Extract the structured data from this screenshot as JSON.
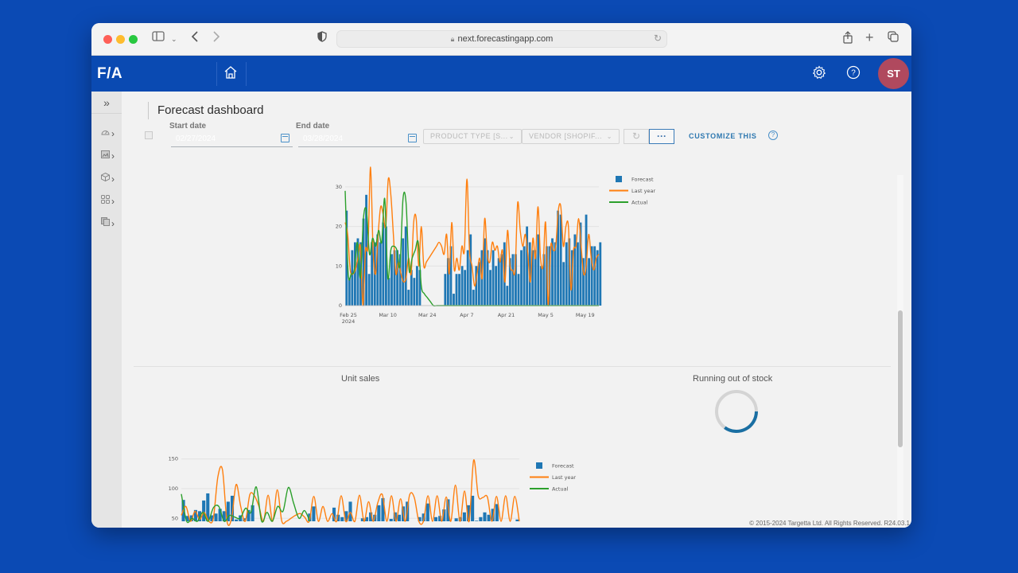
{
  "browser": {
    "url": "next.forecastingapp.com",
    "icons": [
      "sidebar-icon",
      "chevron-down-icon",
      "back-icon",
      "forward-icon",
      "shield-icon",
      "lock-icon",
      "reload-icon",
      "share-icon",
      "new-tab-icon",
      "tabs-icon"
    ]
  },
  "app": {
    "logo": "F/A",
    "avatar_initials": "ST",
    "colors": {
      "brand": "#0a4ab2",
      "avatar": "#b0495e",
      "forecast": "#1f77b4",
      "last_year": "#ff7f0e",
      "actual": "#2ca02c",
      "accent": "#2e78b0"
    }
  },
  "sidebar": {
    "expand_glyph": "»",
    "items": [
      {
        "name": "dashboard",
        "icon": "gauge-icon"
      },
      {
        "name": "reports",
        "icon": "image-icon"
      },
      {
        "name": "products",
        "icon": "cube-icon"
      },
      {
        "name": "apps",
        "icon": "grid-icon"
      },
      {
        "name": "documents",
        "icon": "copy-icon"
      }
    ]
  },
  "page": {
    "title": "Forecast dashboard",
    "filters": {
      "start_date_label": "Start date",
      "start_date_value": "02/27/2024",
      "end_date_label": "End date",
      "end_date_value": "03/28/2024",
      "product_type": "PRODUCT TYPE [S...",
      "vendor": "VENDOR [SHOPIF...",
      "more_label": "···",
      "customize_label": "CUSTOMIZE THIS",
      "help_label": "?"
    }
  },
  "sections": {
    "unit_sales_title": "Unit sales",
    "running_out_title": "Running out of stock",
    "spinner_progress": 0.35
  },
  "footer": {
    "text": "© 2015-2024 Targetta Ltd. All Rights Reserved. R24.03.1"
  },
  "chart_data": [
    {
      "type": "bar",
      "title": "",
      "legend": [
        "Forecast",
        "Last year",
        "Actual"
      ],
      "legend_position": "top-right",
      "x_start": "2024-02-25",
      "x_ticks": [
        "Feb 25\n2024",
        "Mar 10",
        "Mar 24",
        "Apr 7",
        "Apr 21",
        "May 5",
        "May 19"
      ],
      "y_ticks": [
        0,
        10,
        20,
        30
      ],
      "ylim": [
        0,
        35
      ],
      "days": 88,
      "series": [
        {
          "name": "Forecast",
          "kind": "bar",
          "values": [
            24,
            7,
            14,
            16,
            17,
            16,
            22,
            28,
            8,
            16,
            16,
            18,
            16,
            21,
            20,
            7,
            13,
            14,
            14,
            13,
            17,
            20,
            4,
            9,
            7,
            10,
            9,
            0,
            0,
            0,
            0,
            0,
            0,
            0,
            0,
            8,
            12,
            15,
            3,
            8,
            8,
            10,
            9,
            14,
            18,
            4,
            10,
            11,
            14,
            17,
            14,
            9,
            14,
            10,
            12,
            13,
            16,
            5,
            12,
            13,
            13,
            8,
            14,
            15,
            20,
            16,
            14,
            14,
            18,
            10,
            13,
            15,
            15,
            17,
            16,
            24,
            23,
            11,
            16,
            17,
            14,
            18,
            16,
            21,
            12,
            23,
            12,
            15,
            15,
            14,
            16
          ]
        },
        {
          "name": "Last year",
          "kind": "line",
          "values": [
            21,
            18,
            9,
            8,
            9,
            12,
            15,
            0,
            14,
            15,
            35,
            14,
            8,
            18,
            25,
            23,
            20,
            32,
            28,
            18,
            8,
            11,
            8,
            6,
            7,
            12,
            8,
            21,
            22,
            10,
            20,
            10,
            11,
            12,
            13,
            14,
            15,
            16,
            15,
            13,
            18,
            8,
            21,
            9,
            12,
            9,
            15,
            14,
            32,
            14,
            10,
            5,
            8,
            12,
            7,
            22,
            13,
            11,
            16,
            14,
            15,
            11,
            14,
            6,
            19,
            10,
            9,
            9,
            26,
            19,
            15,
            18,
            13,
            6,
            17,
            12,
            25,
            12,
            10,
            21,
            0,
            15,
            14,
            15,
            24,
            25,
            15,
            20,
            20,
            4,
            14,
            15,
            22,
            15,
            8,
            10,
            18,
            12,
            9,
            12,
            13
          ]
        },
        {
          "name": "Actual",
          "kind": "line",
          "values": [
            29,
            8,
            8,
            9,
            16,
            7,
            22,
            24,
            13,
            17,
            15,
            19,
            16,
            27,
            7,
            14,
            15,
            14,
            10,
            27,
            26,
            9,
            12,
            14,
            16,
            5,
            3,
            2,
            1,
            0,
            0
          ]
        }
      ]
    },
    {
      "type": "bar",
      "title": "Unit sales",
      "legend": [
        "Forecast",
        "Last year",
        "Actual"
      ],
      "legend_position": "top-right",
      "y_ticks": [
        50,
        100,
        150
      ],
      "ylim": [
        45,
        155
      ],
      "series": [
        {
          "name": "Forecast",
          "kind": "bar",
          "values": [
            81,
            54,
            55,
            64,
            62,
            80,
            92,
            55,
            58,
            66,
            62,
            78,
            88,
            48,
            55,
            50,
            64,
            72,
            45,
            45,
            45,
            45,
            45,
            45,
            45,
            45,
            45,
            45,
            45,
            45,
            45,
            58,
            70,
            45,
            45,
            45,
            45,
            68,
            56,
            52,
            62,
            78,
            45,
            45,
            50,
            52,
            60,
            56,
            72,
            84,
            45,
            49,
            60,
            56,
            70,
            78,
            45,
            45,
            52,
            58,
            75,
            45,
            52,
            54,
            65,
            82,
            45,
            50,
            52,
            60,
            72,
            88,
            46,
            52,
            60,
            56,
            66,
            74,
            45,
            45,
            45,
            45,
            48
          ]
        },
        {
          "name": "Last year",
          "kind": "line",
          "values": [
            55,
            70,
            45,
            62,
            48,
            60,
            45,
            50,
            120,
            132,
            45,
            50,
            107,
            70,
            45,
            90,
            88,
            70,
            45,
            89,
            45,
            98,
            45,
            45,
            50,
            55,
            58,
            52,
            45,
            87,
            45,
            70,
            45,
            58,
            45,
            88,
            45,
            60,
            45,
            89,
            45,
            78,
            45,
            76,
            90,
            45,
            88,
            45,
            83,
            45,
            90,
            85,
            45,
            45,
            88,
            45,
            88,
            45,
            86,
            45,
            106,
            45,
            96,
            45,
            148,
            88,
            85,
            86,
            45,
            87,
            45,
            88,
            45,
            87,
            45
          ]
        },
        {
          "name": "Actual",
          "kind": "line",
          "values": [
            91,
            45,
            50,
            45,
            60,
            45,
            68,
            70,
            45,
            55,
            52,
            50,
            67,
            60,
            103,
            45,
            60,
            45,
            70,
            62,
            102,
            75,
            50,
            63,
            45
          ]
        }
      ]
    }
  ]
}
